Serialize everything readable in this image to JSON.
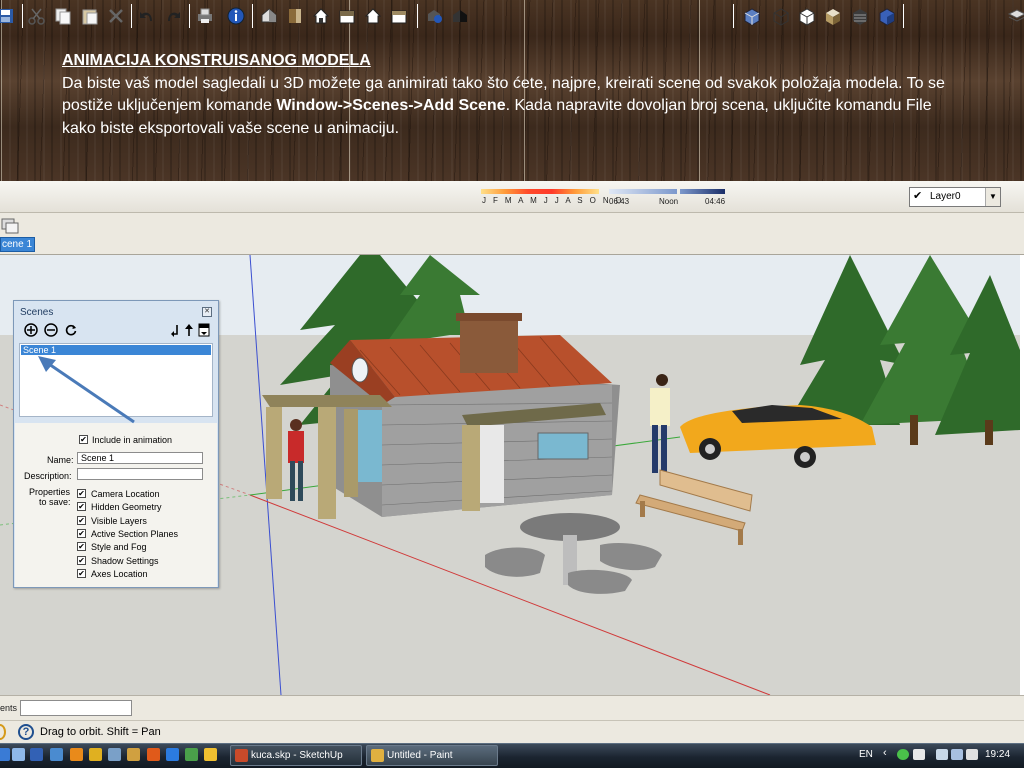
{
  "header": {
    "title": "ANIMACIJA KONSTRUISANOG MODELA",
    "body_pre": "Da biste vaš model sagledali u 3D možete ga animirati tako što  ćete, najpre, kreirati scene od svakok položaja modela. To se postiže uključenjem komande ",
    "body_bold": "Window->Scenes->Add Scene",
    "body_post": ". Kada napravite dovoljan broj scena, uključite komandu File kako biste eksportovali vaše scene u animaciju."
  },
  "toolbar": {
    "months": "J F M A M J J A S O N D",
    "time_start": "06:43",
    "time_mid": "Noon",
    "time_end": "04:46",
    "layer": "Layer0"
  },
  "scene_tab": {
    "label": "cene 1"
  },
  "scenes_panel": {
    "title": "Scenes",
    "list_item": "Scene 1",
    "include_label": "Include in animation",
    "name_label": "Name:",
    "name_value": "Scene 1",
    "description_label": "Description:",
    "description_value": "",
    "properties_label_1": "Properties",
    "properties_label_2": "to save:",
    "properties": [
      "Camera Location",
      "Hidden Geometry",
      "Visible Layers",
      "Active Section Planes",
      "Style and Fog",
      "Shadow Settings",
      "Axes Location"
    ]
  },
  "vcb": {
    "label": "ents"
  },
  "status": {
    "text": "Drag to orbit.  Shift = Pan"
  },
  "taskbar": {
    "tasks": [
      "kuca.skp - SketchUp",
      "Untitled - Paint"
    ],
    "language": "EN",
    "clock": "19:24"
  },
  "colors": {
    "selection_blue": "#3b86d6",
    "panel_bg": "#d8e4f1",
    "arrow_blue": "#4a7ab8",
    "car_yellow": "#f2a81c",
    "roof_orange": "#b8502c"
  }
}
